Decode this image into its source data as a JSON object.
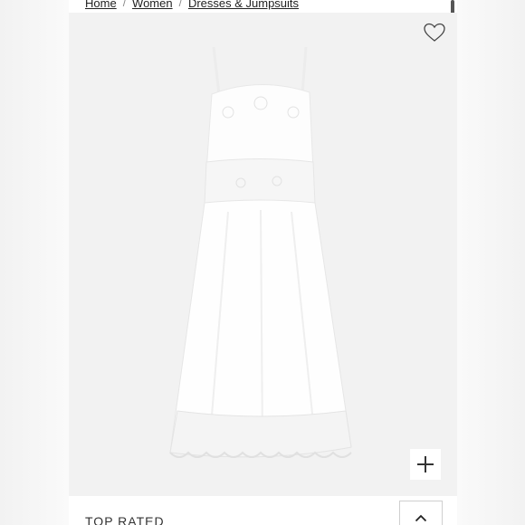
{
  "breadcrumb": {
    "items": [
      "Home",
      "Women",
      "Dresses & Jumpsuits"
    ],
    "separator": "/"
  },
  "product": {
    "image_icon": "dress-image",
    "wishlist_icon": "heart-outline-icon",
    "zoom_icon": "plus-icon"
  },
  "accordion": {
    "label": "TOP RATED",
    "toggle_icon": "chevron-up-icon"
  },
  "colors": {
    "image_background": "#f2f2f2",
    "dress": "#fdfdfd",
    "lace": "#e6e6e6"
  }
}
